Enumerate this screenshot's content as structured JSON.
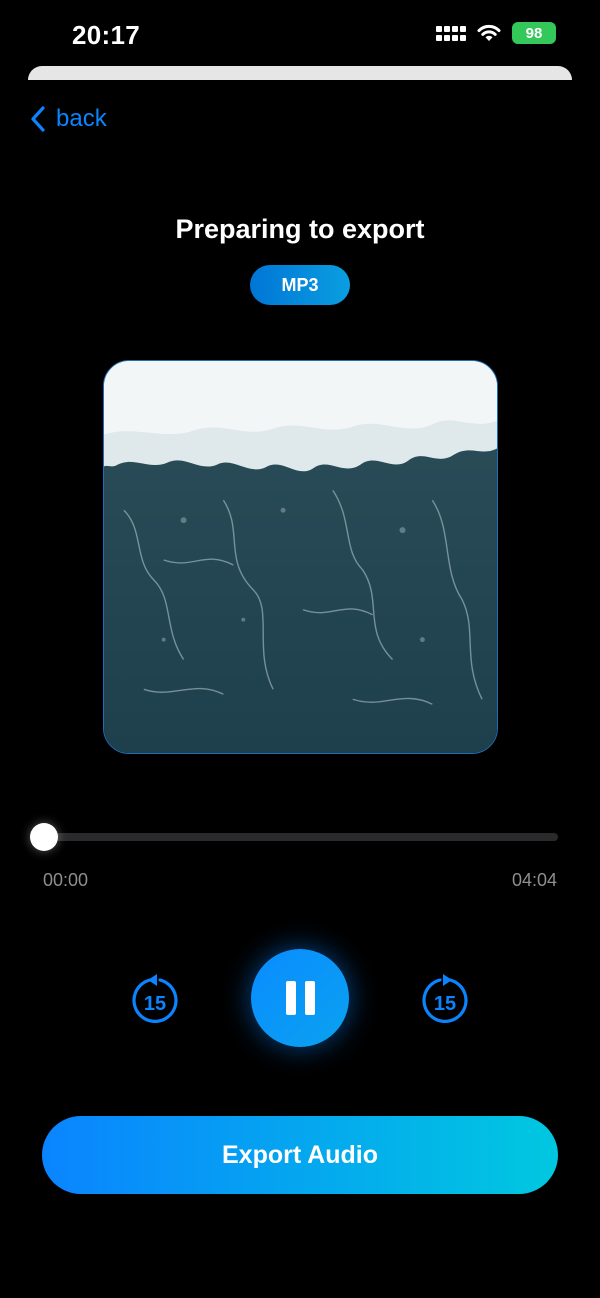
{
  "status_bar": {
    "time": "20:17",
    "battery": "98"
  },
  "nav": {
    "back_label": "back",
    "back_icon": "chevron-left-icon",
    "accent_color": "#0a84ff"
  },
  "export_screen": {
    "title": "Preparing to export",
    "format_badge": "MP3"
  },
  "player": {
    "elapsed": "00:00",
    "duration": "04:04",
    "progress_fraction": 0,
    "skip_back_seconds": "15",
    "skip_forward_seconds": "15",
    "state": "playing",
    "artwork": "ocean-wave-aerial-image"
  },
  "actions": {
    "export_label": "Export Audio"
  }
}
